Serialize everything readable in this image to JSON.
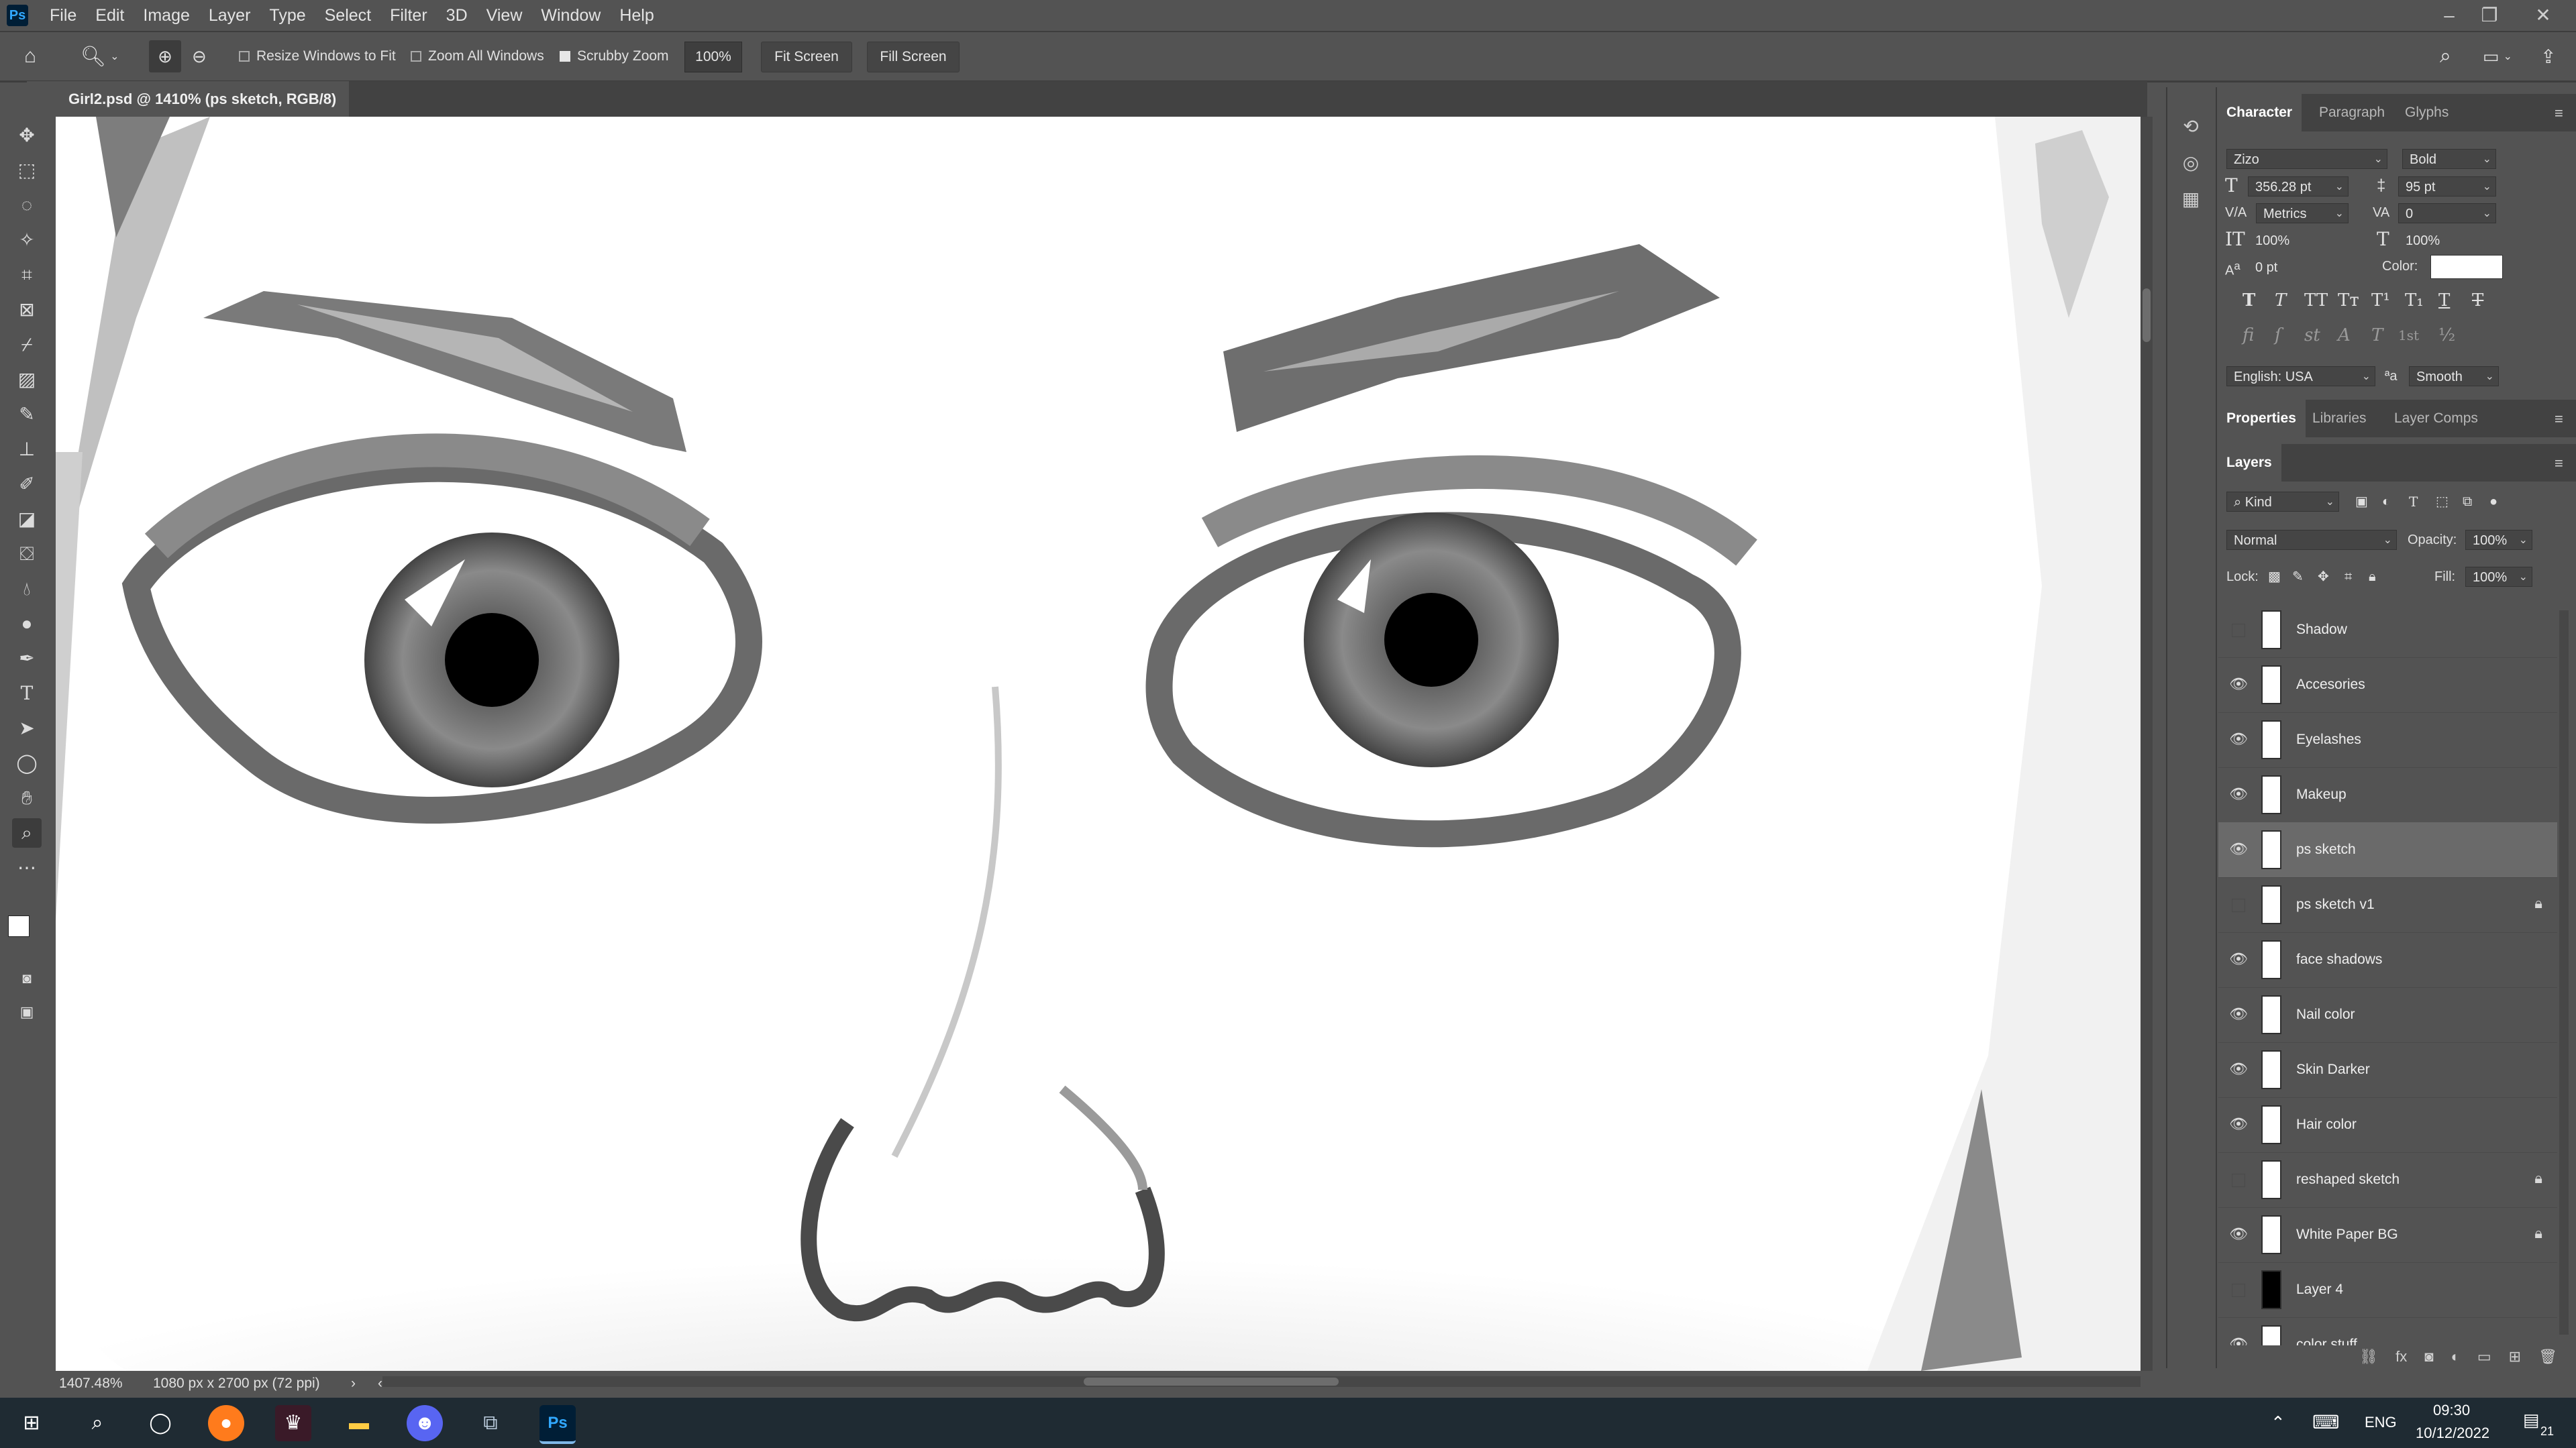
{
  "app": {
    "logo": "Ps",
    "menu": [
      "File",
      "Edit",
      "Image",
      "Layer",
      "Type",
      "Select",
      "Filter",
      "3D",
      "View",
      "Window",
      "Help"
    ]
  },
  "options_bar": {
    "resize_windows_label": "Resize Windows to Fit",
    "zoom_all_label": "Zoom All Windows",
    "scrubby_zoom_label": "Scrubby Zoom",
    "zoom_value": "100%",
    "fit_screen_label": "Fit Screen",
    "fill_screen_label": "Fill Screen"
  },
  "document": {
    "tab_title": "Girl2.psd @ 1410% (ps sketch, RGB/8)",
    "zoom_status": "1407.48%",
    "size_status": "1080 px x 2700 px (72 ppi)"
  },
  "character_panel": {
    "tabs": [
      "Character",
      "Paragraph",
      "Glyphs"
    ],
    "font_family": "Zizo",
    "font_style": "Bold",
    "font_size": "356.28 pt",
    "leading": "95 pt",
    "kerning": "Metrics",
    "tracking": "0",
    "vertical_scale": "100%",
    "horizontal_scale": "100%",
    "baseline_shift": "0 pt",
    "color_label": "Color:",
    "language": "English: USA",
    "antialias": "Smooth",
    "type_style_glyphs": [
      "T",
      "T",
      "TT",
      "Tт",
      "T¹",
      "T₁",
      "T",
      "T"
    ],
    "opentype_glyphs": [
      "fi",
      "ſ",
      "st",
      "A",
      "T",
      "1st",
      "½"
    ]
  },
  "properties_tabs": [
    "Properties",
    "Libraries",
    "Layer Comps"
  ],
  "layers_panel": {
    "title": "Layers",
    "filter_kind": "Kind",
    "blend_mode": "Normal",
    "opacity_label": "Opacity:",
    "opacity_value": "100%",
    "lock_label": "Lock:",
    "fill_label": "Fill:",
    "fill_value": "100%",
    "layers": [
      {
        "name": "Shadow",
        "visible": false,
        "locked": false,
        "selected": false,
        "thumb": "white"
      },
      {
        "name": "Accesories",
        "visible": true,
        "locked": false,
        "selected": false,
        "thumb": "white"
      },
      {
        "name": "Eyelashes",
        "visible": true,
        "locked": false,
        "selected": false,
        "thumb": "white"
      },
      {
        "name": "Makeup",
        "visible": true,
        "locked": false,
        "selected": false,
        "thumb": "white"
      },
      {
        "name": "ps sketch",
        "visible": true,
        "locked": false,
        "selected": true,
        "thumb": "white"
      },
      {
        "name": "ps sketch v1",
        "visible": false,
        "locked": true,
        "selected": false,
        "thumb": "white"
      },
      {
        "name": "face shadows",
        "visible": true,
        "locked": false,
        "selected": false,
        "thumb": "white"
      },
      {
        "name": "Nail color",
        "visible": true,
        "locked": false,
        "selected": false,
        "thumb": "white"
      },
      {
        "name": "Skin Darker",
        "visible": true,
        "locked": false,
        "selected": false,
        "thumb": "white"
      },
      {
        "name": "Hair color",
        "visible": true,
        "locked": false,
        "selected": false,
        "thumb": "white"
      },
      {
        "name": "reshaped sketch",
        "visible": false,
        "locked": true,
        "selected": false,
        "thumb": "white"
      },
      {
        "name": "White Paper BG",
        "visible": true,
        "locked": true,
        "selected": false,
        "thumb": "white"
      },
      {
        "name": "Layer 4",
        "visible": false,
        "locked": false,
        "selected": false,
        "thumb": "black"
      },
      {
        "name": "color stuff",
        "visible": true,
        "locked": false,
        "selected": false,
        "thumb": "white"
      }
    ]
  },
  "taskbar": {
    "language": "ENG",
    "time": "09:30",
    "date": "10/12/2022",
    "notification_count": "21"
  },
  "colors": {
    "ui_bg": "#535353",
    "panel_dark": "#424242",
    "selected_row": "#6a6a6a",
    "taskbar": "#1f2b33",
    "ps_blue": "#31a8ff"
  }
}
